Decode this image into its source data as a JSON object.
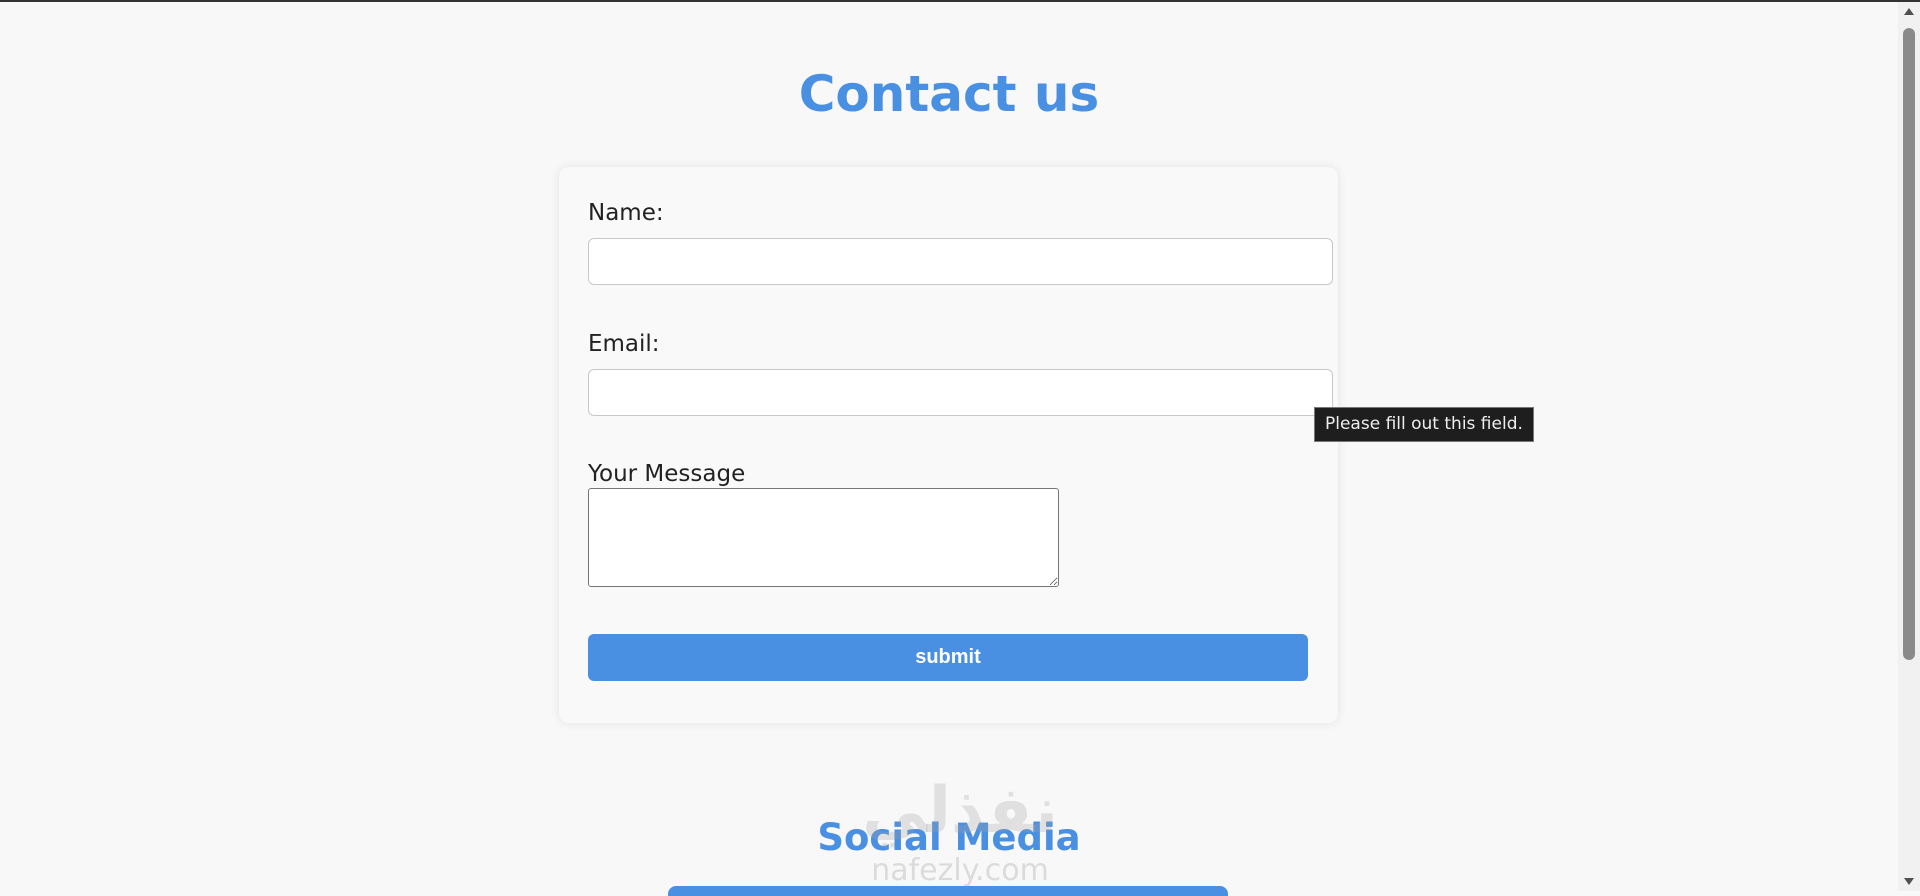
{
  "page": {
    "title": "Contact us"
  },
  "form": {
    "name_label": "Name:",
    "name_value": "",
    "email_label": "Email:",
    "email_value": "",
    "message_label": "Your Message",
    "message_value": "",
    "submit_label": "submit"
  },
  "tooltip": {
    "text": "Please fill out this field."
  },
  "social": {
    "title": "Social Media"
  },
  "watermark": {
    "arabic": "نفذلي",
    "latin": "nafezly.com"
  },
  "colors": {
    "accent": "#4a90e2",
    "background": "#f8f8f8",
    "tooltip_bg": "#1e1e1e"
  }
}
